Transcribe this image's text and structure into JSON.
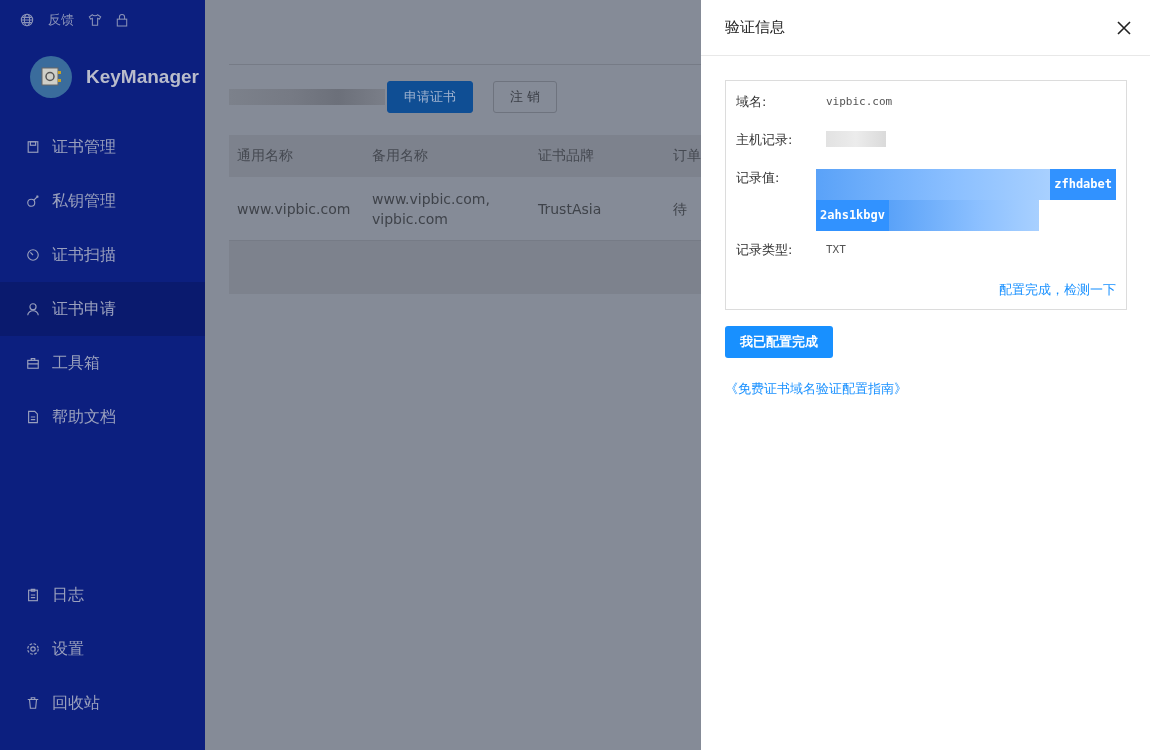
{
  "sidebar": {
    "top_links": [
      {
        "kind": "globe"
      },
      {
        "kind": "text",
        "label": "反馈"
      },
      {
        "kind": "shirt"
      },
      {
        "kind": "lock"
      }
    ],
    "brand": "KeyManager",
    "items": [
      {
        "label": "证书管理",
        "kind": "cert",
        "selected": false
      },
      {
        "label": "私钥管理",
        "kind": "key",
        "selected": false
      },
      {
        "label": "证书扫描",
        "kind": "scan",
        "selected": false
      },
      {
        "label": "证书申请",
        "kind": "user",
        "selected": true
      },
      {
        "label": "工具箱",
        "kind": "toolbox",
        "selected": false
      },
      {
        "label": "帮助文档",
        "kind": "doc",
        "selected": false
      }
    ],
    "bottom_items": [
      {
        "label": "日志",
        "kind": "log",
        "selected": false
      },
      {
        "label": "设置",
        "kind": "gear",
        "selected": false
      },
      {
        "label": "回收站",
        "kind": "trash",
        "selected": false
      }
    ]
  },
  "toolbar": {
    "buttons": [
      {
        "label": "申请证书",
        "kind": "primary"
      },
      {
        "label": "注 销",
        "kind": "default"
      }
    ]
  },
  "table": {
    "columns": [
      "通用名称",
      "备用名称",
      "证书品牌",
      "订单"
    ],
    "rows": [
      [
        "www.vipbic.com",
        "www.vipbic.com, vipbic.com",
        "TrustAsia",
        "待"
      ]
    ]
  },
  "drawer": {
    "title": "验证信息",
    "fields": [
      {
        "label": "域名:",
        "value": "vipbic.com",
        "kind": "plain"
      },
      {
        "label": "主机记录:",
        "kind": "redacted"
      },
      {
        "label": "记录值:",
        "kind": "selected",
        "lines": [
          "zfhdabet",
          "2ahs1kbgv"
        ]
      },
      {
        "label": "记录类型:",
        "value": "TXT",
        "kind": "plain"
      }
    ],
    "check_link": "配置完成，检测一下",
    "confirm_button": "我已配置完成",
    "guide_link": "《免费证书域名验证配置指南》"
  }
}
